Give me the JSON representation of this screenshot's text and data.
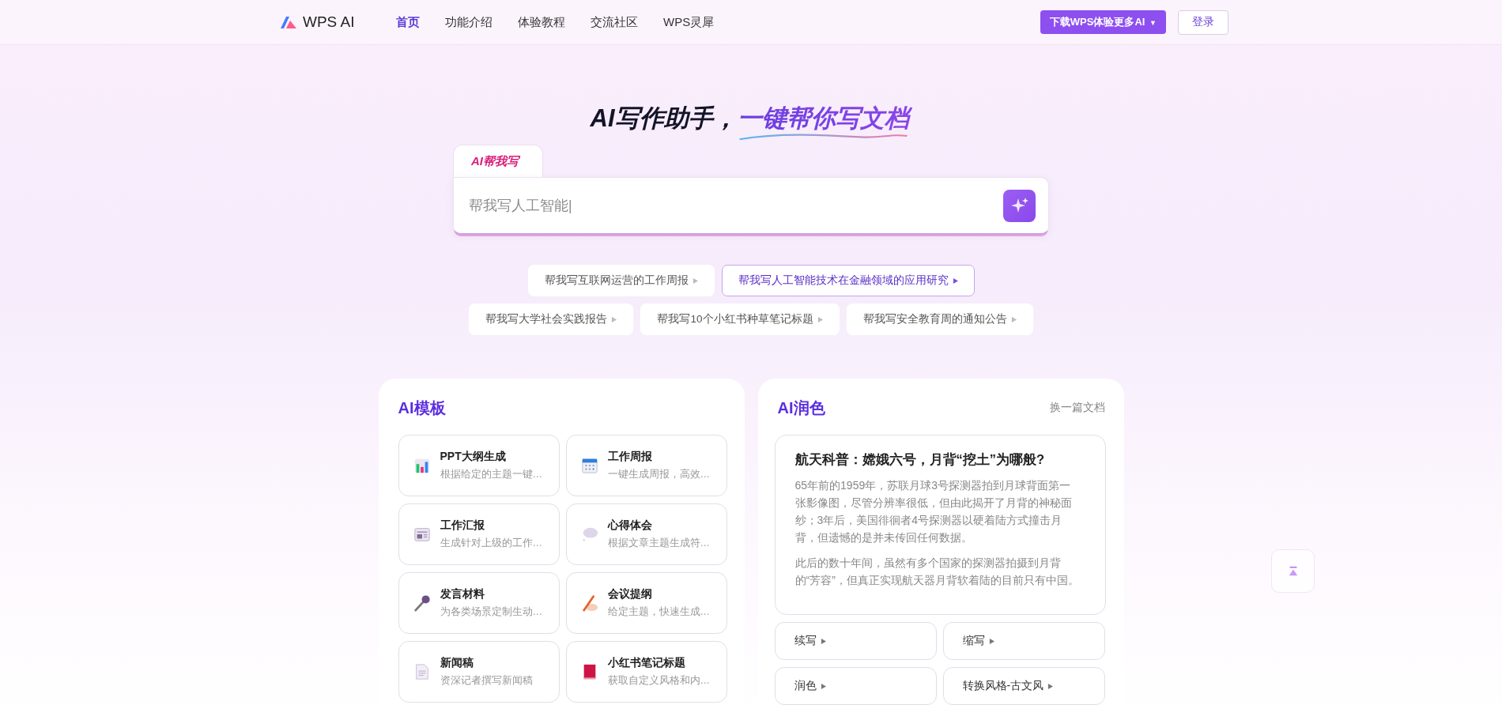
{
  "header": {
    "logo": "WPS AI",
    "nav": [
      {
        "label": "首页",
        "selected": true
      },
      {
        "label": "功能介绍",
        "selected": false
      },
      {
        "label": "体验教程",
        "selected": false
      },
      {
        "label": "交流社区",
        "selected": false
      },
      {
        "label": "WPS灵犀",
        "selected": false
      }
    ],
    "download_button": {
      "label": "下载WPS体验更多AI",
      "caret": "▼"
    },
    "login_button": "登录"
  },
  "hero": {
    "title_lead": "AI写作助手，",
    "title_highlight": "一键帮你写文档",
    "tab": "AI帮我写",
    "input": {
      "placeholder": "帮我写人工智能|"
    },
    "suggestions": [
      {
        "label": "帮我写互联网运营的工作周报",
        "selected": false
      },
      {
        "label": "帮我写人工智能技术在金融领域的应用研究",
        "selected": true
      },
      {
        "label": "帮我写大学社会实践报告",
        "selected": false
      },
      {
        "label": "帮我写10个小红书种草笔记标题",
        "selected": false
      },
      {
        "label": "帮我写安全教育周的通知公告",
        "selected": false
      }
    ]
  },
  "templates": {
    "title": "AI模板",
    "items": [
      {
        "title": "PPT大纲生成",
        "desc": "根据给定的主题一键…",
        "kind": "chart"
      },
      {
        "title": "工作周报",
        "desc": "一键生成周报，高效…",
        "kind": "calendar"
      },
      {
        "title": "工作汇报",
        "desc": "生成针对上级的工作…",
        "kind": "newspaper"
      },
      {
        "title": "心得体会",
        "desc": "根据文章主题生成符…",
        "kind": "bubble"
      },
      {
        "title": "发言材料",
        "desc": "为各类场景定制生动…",
        "kind": "microphone"
      },
      {
        "title": "会议提纲",
        "desc": "给定主题，快速生成…",
        "kind": "pencil"
      },
      {
        "title": "新闻稿",
        "desc": "资深记者撰写新闻稿",
        "kind": "document"
      },
      {
        "title": "小红书笔记标题",
        "desc": "获取自定义风格和内…",
        "kind": "book"
      }
    ]
  },
  "polish": {
    "title": "AI润色",
    "switch_link": "换一篇文档",
    "article": {
      "heading": "航天科普：嫦娥六号，月背“挖土”为哪般?",
      "paragraphs": [
        "65年前的1959年，苏联月球3号探测器拍到月球背面第一张影像图，尽管分辨率很低，但由此揭开了月背的神秘面纱；3年后，美国徘徊者4号探测器以硬着陆方式撞击月背，但遗憾的是并未传回任何数据。",
        "此后的数十年间，虽然有多个国家的探测器拍摄到月背的“芳容”，但真正实现航天器月背软着陆的目前只有中国。"
      ]
    },
    "actions": [
      "续写",
      "缩写",
      "润色",
      "转换风格-古文风"
    ]
  }
}
